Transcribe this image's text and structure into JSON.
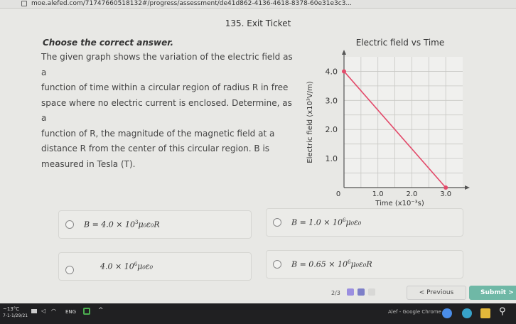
{
  "browser": {
    "url": "moe.alefed.com/71747660518132#/progress/assessment/de41d862-4136-4618-8378-60e31e3c3..."
  },
  "page": {
    "title": "135. Exit Ticket"
  },
  "question": {
    "instruction": "Choose the correct answer.",
    "lines": [
      "The given graph shows the variation of the electric field as a",
      "function of time within a circular region of radius R in free",
      "space where no electric current is enclosed. Determine, as a",
      "function of R, the magnitude of the magnetic field at a",
      "distance R from the center of this circular region.  B is",
      "measured in Tesla (T)."
    ]
  },
  "chart_data": {
    "type": "line",
    "title": "Electric field vs Time",
    "xlabel": "Time (x10⁻³s)",
    "ylabel": "Electric field (x10³V/m)",
    "x_ticks": [
      "0",
      "1.0",
      "2.0",
      "3.0"
    ],
    "y_ticks": [
      "1.0",
      "2.0",
      "3.0",
      "4.0"
    ],
    "xlim": [
      0,
      3.5
    ],
    "ylim": [
      0,
      4.5
    ],
    "grid": true,
    "series": [
      {
        "x": [
          0,
          3.0
        ],
        "y": [
          4.0,
          0
        ],
        "color": "#e24a6a"
      }
    ]
  },
  "options": [
    {
      "prefix": "B = 4.0 × 10",
      "exp": "3",
      "suffix": "μ₀ε₀R"
    },
    {
      "prefix": "B = 1.0 × 10",
      "exp": "6",
      "suffix": "μ₀ε₀"
    },
    {
      "prefix": "4.0 × 10",
      "exp": "6",
      "suffix": "μ₀ε₀"
    },
    {
      "prefix": "B = 0.65 × 10",
      "exp": "6",
      "suffix": "μ₀ε₀R"
    }
  ],
  "nav": {
    "progress": "2/3",
    "previous": "< Previous",
    "submit": "Submit >",
    "dot_colors": [
      "#9b8fe0",
      "#7d7fc8",
      "#d8d8d6"
    ]
  },
  "taskbar": {
    "weather": "~13°C",
    "date": "7-1-1/29/21",
    "language": "ENG",
    "window_title": "Alef - Google Chrome"
  }
}
